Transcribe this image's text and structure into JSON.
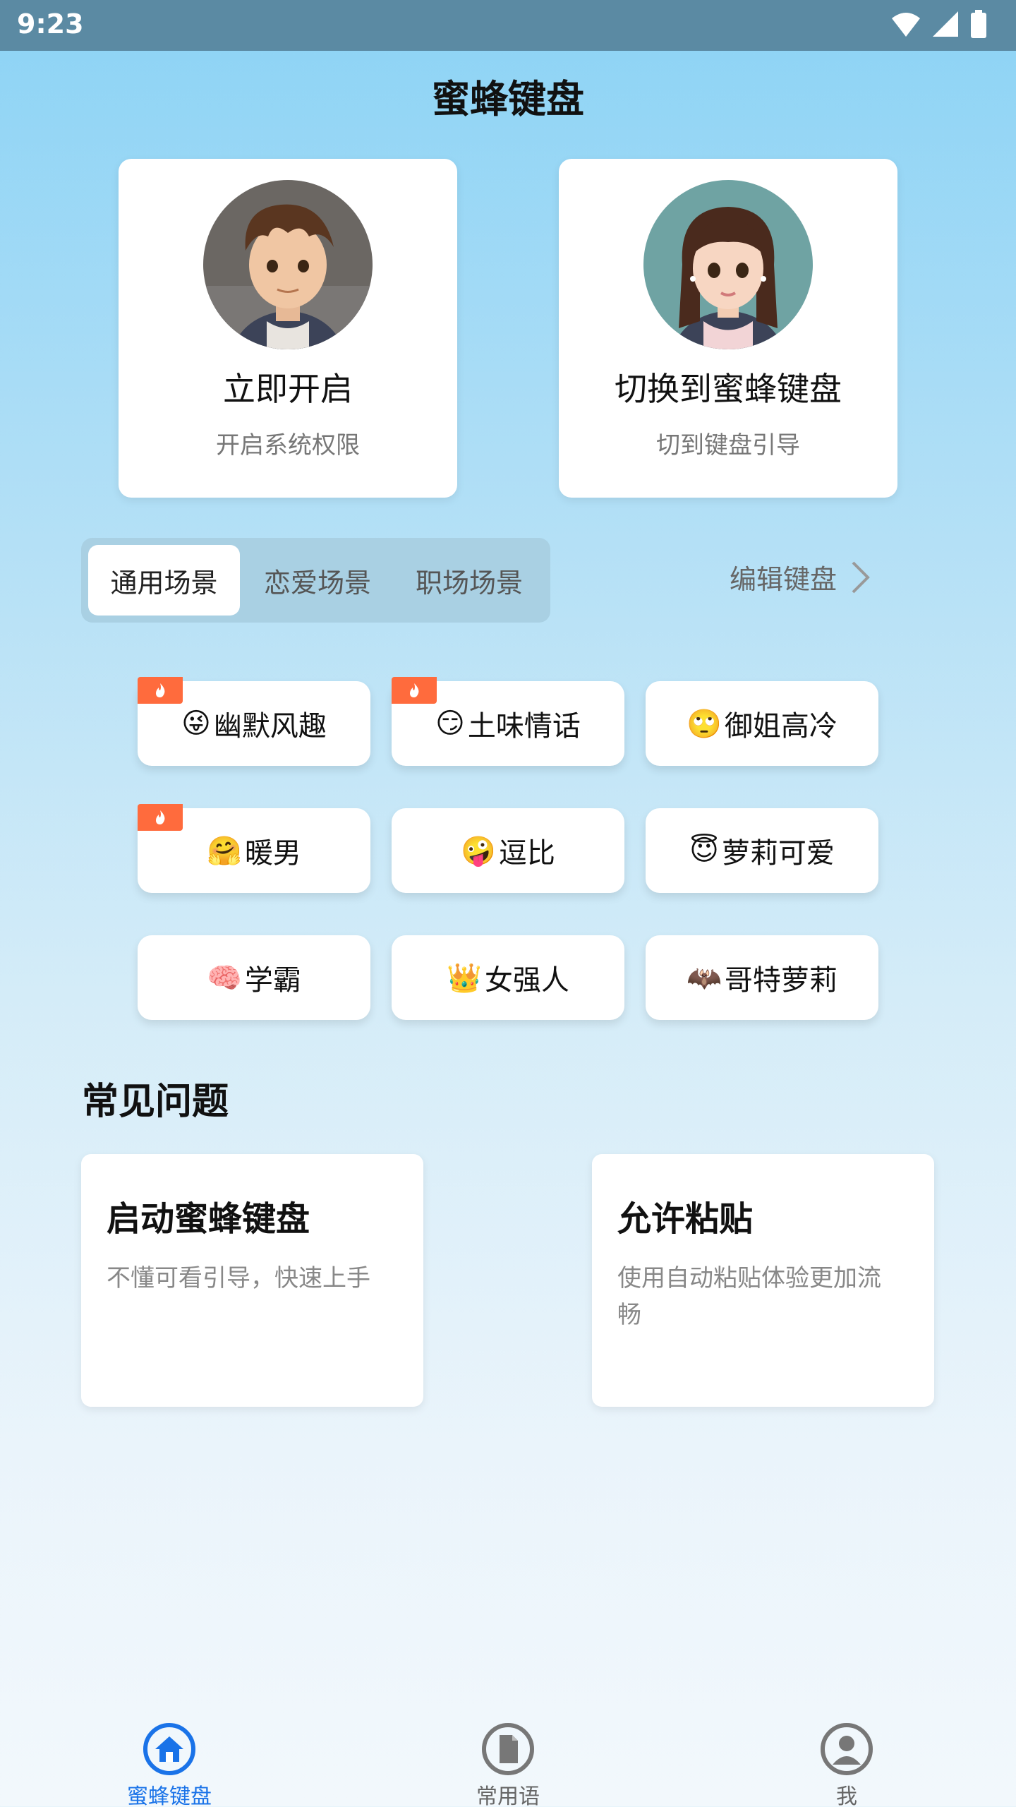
{
  "status": {
    "time": "9:23"
  },
  "app_title": "蜜蜂键盘",
  "hero_cards": [
    {
      "title": "立即开启",
      "subtitle": "开启系统权限"
    },
    {
      "title": "切换到蜜蜂键盘",
      "subtitle": "切到键盘引导"
    }
  ],
  "tabs": [
    {
      "label": "通用场景",
      "active": true
    },
    {
      "label": "恋爱场景",
      "active": false
    },
    {
      "label": "职场场景",
      "active": false
    }
  ],
  "edit_keyboard": "编辑键盘",
  "scenes": [
    {
      "emoji": "😜",
      "label": "幽默风趣",
      "hot": true
    },
    {
      "emoji": "😏",
      "label": "土味情话",
      "hot": true
    },
    {
      "emoji": "🙄",
      "label": "御姐高冷",
      "hot": false
    },
    {
      "emoji": "🤗",
      "label": "暖男",
      "hot": true
    },
    {
      "emoji": "🤪",
      "label": "逗比",
      "hot": false
    },
    {
      "emoji": "😇",
      "label": "萝莉可爱",
      "hot": false
    },
    {
      "emoji": "🧠",
      "label": "学霸",
      "hot": false
    },
    {
      "emoji": "👑",
      "label": "女强人",
      "hot": false
    },
    {
      "emoji": "🦇",
      "label": "哥特萝莉",
      "hot": false
    }
  ],
  "faq": {
    "heading": "常见问题",
    "cards": [
      {
        "title": "启动蜜蜂键盘",
        "desc": "不懂可看引导，快速上手"
      },
      {
        "title": "允许粘贴",
        "desc": "使用自动粘贴体验更加流畅"
      }
    ]
  },
  "nav": [
    {
      "label": "蜜蜂键盘",
      "icon": "home-icon",
      "active": true
    },
    {
      "label": "常用语",
      "icon": "document-icon",
      "active": false
    },
    {
      "label": "我",
      "icon": "profile-icon",
      "active": false
    }
  ],
  "colors": {
    "accent": "#1a73e8",
    "hot_badge": "#ff6b3d",
    "status_bar": "#5b8aa3"
  }
}
